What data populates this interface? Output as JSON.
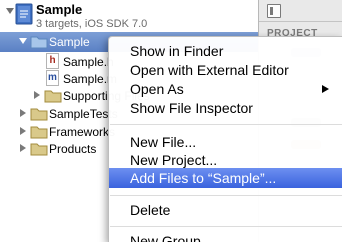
{
  "project": {
    "name": "Sample",
    "subtitle": "3 targets, iOS SDK 7.0"
  },
  "tree": [
    {
      "label": "Sample",
      "kind": "group",
      "expanded": true,
      "selected": true,
      "indent": 0
    },
    {
      "label": "Sample.h",
      "kind": "header-file",
      "indent": 1
    },
    {
      "label": "Sample.m",
      "kind": "implementation-file",
      "indent": 1
    },
    {
      "label": "Supporting Files",
      "kind": "group",
      "expanded": false,
      "indent": 1
    },
    {
      "label": "SampleTests",
      "kind": "group",
      "expanded": false,
      "indent": 0
    },
    {
      "label": "Frameworks",
      "kind": "group",
      "expanded": false,
      "indent": 0
    },
    {
      "label": "Products",
      "kind": "group",
      "expanded": false,
      "indent": 0
    }
  ],
  "file_badges": {
    "header": "h",
    "implementation": "m"
  },
  "utility": {
    "section_title": "PROJECT"
  },
  "context_menu": {
    "items": [
      {
        "label": "Show in Finder"
      },
      {
        "label": "Open with External Editor"
      },
      {
        "label": "Open As",
        "submenu": true
      },
      {
        "label": "Show File Inspector"
      },
      {
        "label": "New File..."
      },
      {
        "label": "New Project..."
      },
      {
        "label": "Add Files to “Sample”...",
        "highlighted": true
      },
      {
        "label": "Delete"
      },
      {
        "label": "New Group"
      }
    ]
  },
  "colors": {
    "selection": "#6b8ccc",
    "menu_highlight": "#4a72e4",
    "folder": "#8fb5e0",
    "header_file": "#a5291f",
    "implementation_file": "#2a4f9e"
  }
}
